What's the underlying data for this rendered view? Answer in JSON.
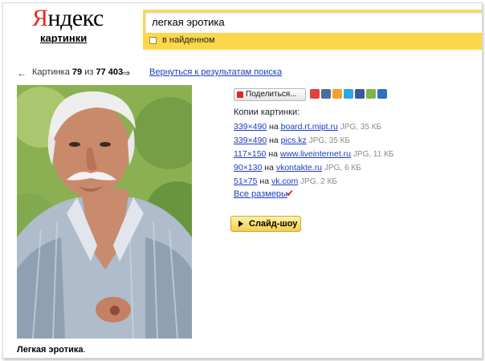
{
  "header": {
    "logo_first": "Я",
    "logo_rest": "ндекс",
    "logo_sub": "картинки"
  },
  "search": {
    "value": "легкая эротика",
    "checkbox_label": "в найденном"
  },
  "nav": {
    "prev_arrow": "←",
    "counter_prefix": "Картинка",
    "counter_current": "79",
    "counter_of": "из",
    "counter_total": "77 403",
    "next_arrow": "⇒",
    "back_link": "Вернуться к результатам поиска"
  },
  "photo": {
    "caption_bold": "Легкая эротика",
    "caption_tail": "."
  },
  "share": {
    "button_label": "Поделиться...",
    "icons": [
      "yaru-icon",
      "vkontakte-icon",
      "odnoklassniki-icon",
      "twitter-icon",
      "facebook-icon",
      "moikrug-icon",
      "livejournal-icon"
    ],
    "colors": {
      "yaru-icon": "#e04040",
      "vkontakte-icon": "#4c6f9a",
      "odnoklassniki-icon": "#f2a12b",
      "twitter-icon": "#2aa9e0",
      "facebook-icon": "#3b5998",
      "moikrug-icon": "#7eb44a",
      "livejournal-icon": "#2f6fbe"
    }
  },
  "copies": {
    "title": "Копии картинки:",
    "on_word": "на",
    "rows": [
      {
        "dim": "339×490",
        "site": "board.rt.mipt.ru",
        "meta": "JPG, 35 КБ"
      },
      {
        "dim": "339×490",
        "site": "pics.kz",
        "meta": "JPG, 35 КБ"
      },
      {
        "dim": "117×150",
        "site": "www.liveinternet.ru",
        "meta": "JPG, 11 КБ"
      },
      {
        "dim": "90×130",
        "site": "vkontakte.ru",
        "meta": "JPG, 6 КБ"
      },
      {
        "dim": "51×75",
        "site": "vk.com",
        "meta": "JPG, 2 КБ"
      }
    ],
    "all_sizes": "Все размеры",
    "check": "✔"
  },
  "slideshow": {
    "label": "Слайд-шоу"
  },
  "colors": {
    "accent_yellow": "#fcd74c",
    "link_blue": "#1a3dc1",
    "logo_red": "#e8281e"
  }
}
